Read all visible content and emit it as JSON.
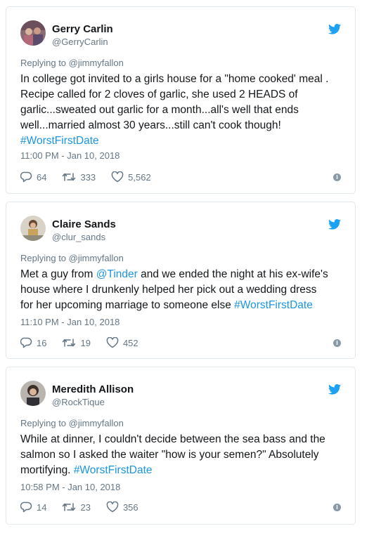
{
  "tweets": [
    {
      "name": "Gerry Carlin",
      "handle": "@GerryCarlin",
      "replying_prefix": "Replying to ",
      "replying_to": "@jimmyfallon",
      "text_lines": [
        "In college got invited to a girls house for a \"home cooked' meal .",
        "Recipe called for 2 cloves of garlic, she used 2 HEADS of",
        "garlic...sweated out garlic for a month...all's well that ends",
        "well...married almost 30 years...still can't cook though!"
      ],
      "hashtag": "#WorstFirstDate",
      "timestamp": "11:00 PM - Jan 10, 2018",
      "replies": "64",
      "retweets": "333",
      "likes": "5,562"
    },
    {
      "name": "Claire Sands",
      "handle": "@clur_sands",
      "replying_prefix": "Replying to ",
      "replying_to": "@jimmyfallon",
      "text_pre": "Met a guy from ",
      "text_mention": "@Tinder",
      "text_mid": " and we ended the night at his ex-wife's",
      "text_lines": [
        "house where I drunkenly helped her pick out a wedding dress"
      ],
      "text_end": "for her upcoming marriage to someone else ",
      "hashtag": "#WorstFirstDate",
      "timestamp": "11:10 PM - Jan 10, 2018",
      "replies": "16",
      "retweets": "19",
      "likes": "452"
    },
    {
      "name": "Meredith Allison",
      "handle": "@RockTique",
      "replying_prefix": "Replying to ",
      "replying_to": "@jimmyfallon",
      "text_lines": [
        "While at dinner, I couldn't decide between the sea bass and the",
        "salmon so I asked the waiter \"how is your semen?\" Absolutely"
      ],
      "text_end": "mortifying. ",
      "hashtag": "#WorstFirstDate",
      "timestamp": "10:58 PM - Jan 10, 2018",
      "replies": "14",
      "retweets": "23",
      "likes": "356"
    }
  ],
  "colors": {
    "link": "#1b95e0",
    "muted": "#657786",
    "border": "#e1e8ed",
    "twitter_blue": "#1da1f2"
  },
  "icons": {
    "brand": "twitter-bird-icon",
    "reply": "reply-icon",
    "retweet": "retweet-icon",
    "like": "heart-icon",
    "info": "info-icon"
  }
}
